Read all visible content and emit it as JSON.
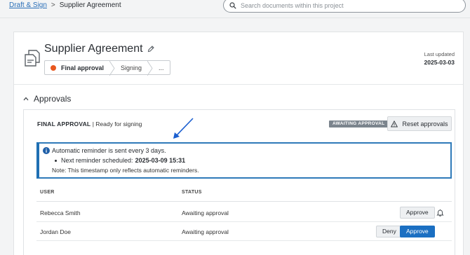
{
  "breadcrumb": {
    "parent": "Draft & Sign",
    "separator": ">",
    "current": "Supplier Agreement"
  },
  "search": {
    "placeholder": "Search documents within this project",
    "value": ""
  },
  "document": {
    "title": "Supplier Agreement",
    "steps": [
      {
        "label": "Final approval",
        "active": true
      },
      {
        "label": "Signing",
        "active": false
      },
      {
        "label": "...",
        "active": false
      }
    ],
    "last_updated_label": "Last updated",
    "last_updated_value": "2025-03-03"
  },
  "approvals": {
    "section_title": "Approvals",
    "card_title": "FINAL APPROVAL",
    "card_subtitle": "| Ready for signing",
    "status_badge": "AWAITING APPROVAL",
    "reset_label": "Reset approvals",
    "info": {
      "line1": "Automatic reminder is sent every 3 days.",
      "line2_prefix": "Next reminder scheduled:",
      "line2_value": "2025-03-09 15:31",
      "line3": "Note: This timestamp only reflects automatic reminders."
    },
    "columns": {
      "user": "USER",
      "status": "STATUS"
    },
    "rows": [
      {
        "user": "Rebecca Smith",
        "status": "Awaiting approval",
        "approve_label": "Approve"
      },
      {
        "user": "Jordan Doe",
        "status": "Awaiting approval",
        "deny_label": "Deny",
        "approve_label": "Approve"
      }
    ]
  },
  "colors": {
    "accent": "#1b6fc2",
    "link": "#2a6fb8",
    "status_dot": "#e8571e",
    "info_border": "#2f7ab9",
    "badge_bg": "#7b848d"
  }
}
